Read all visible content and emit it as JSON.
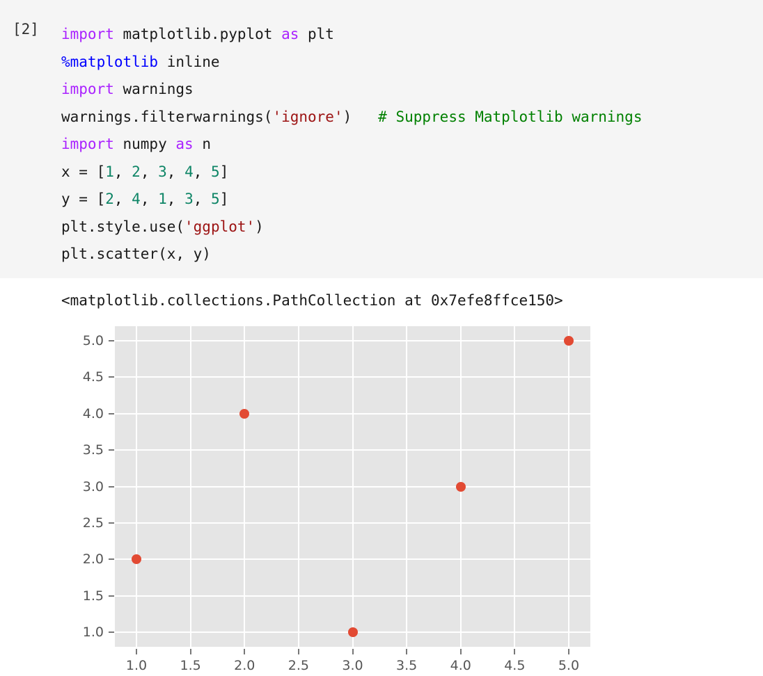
{
  "cell": {
    "prompt": "[2]",
    "lines": [
      [
        {
          "t": "import",
          "c": "kw"
        },
        {
          "t": " matplotlib.pyplot ",
          "c": "plain"
        },
        {
          "t": "as",
          "c": "kw"
        },
        {
          "t": " plt",
          "c": "plain"
        }
      ],
      [
        {
          "t": "%matplotlib",
          "c": "magic"
        },
        {
          "t": " inline",
          "c": "plain"
        }
      ],
      [
        {
          "t": "import",
          "c": "kw"
        },
        {
          "t": " warnings",
          "c": "plain"
        }
      ],
      [
        {
          "t": "warnings.filterwarnings(",
          "c": "plain"
        },
        {
          "t": "'ignore'",
          "c": "str"
        },
        {
          "t": ")   ",
          "c": "plain"
        },
        {
          "t": "# Suppress Matplotlib warnings",
          "c": "cmt"
        }
      ],
      [
        {
          "t": "import",
          "c": "kw"
        },
        {
          "t": " numpy ",
          "c": "plain"
        },
        {
          "t": "as",
          "c": "kw"
        },
        {
          "t": " n",
          "c": "plain"
        }
      ],
      [
        {
          "t": "x = [",
          "c": "plain"
        },
        {
          "t": "1",
          "c": "num"
        },
        {
          "t": ", ",
          "c": "plain"
        },
        {
          "t": "2",
          "c": "num"
        },
        {
          "t": ", ",
          "c": "plain"
        },
        {
          "t": "3",
          "c": "num"
        },
        {
          "t": ", ",
          "c": "plain"
        },
        {
          "t": "4",
          "c": "num"
        },
        {
          "t": ", ",
          "c": "plain"
        },
        {
          "t": "5",
          "c": "num"
        },
        {
          "t": "]",
          "c": "plain"
        }
      ],
      [
        {
          "t": "y = [",
          "c": "plain"
        },
        {
          "t": "2",
          "c": "num"
        },
        {
          "t": ", ",
          "c": "plain"
        },
        {
          "t": "4",
          "c": "num"
        },
        {
          "t": ", ",
          "c": "plain"
        },
        {
          "t": "1",
          "c": "num"
        },
        {
          "t": ", ",
          "c": "plain"
        },
        {
          "t": "3",
          "c": "num"
        },
        {
          "t": ", ",
          "c": "plain"
        },
        {
          "t": "5",
          "c": "num"
        },
        {
          "t": "]",
          "c": "plain"
        }
      ],
      [
        {
          "t": "plt.style.use(",
          "c": "plain"
        },
        {
          "t": "'ggplot'",
          "c": "str"
        },
        {
          "t": ")",
          "c": "plain"
        }
      ],
      [
        {
          "t": "plt.scatter(x, y)",
          "c": "plain"
        }
      ]
    ]
  },
  "output": {
    "repr_text": "<matplotlib.collections.PathCollection at 0x7efe8ffce150>"
  },
  "chart_data": {
    "type": "scatter",
    "title": "",
    "xlabel": "",
    "ylabel": "",
    "x": [
      1,
      2,
      3,
      4,
      5
    ],
    "y": [
      2,
      4,
      1,
      3,
      5
    ],
    "points": [
      {
        "x": 1,
        "y": 2
      },
      {
        "x": 2,
        "y": 4
      },
      {
        "x": 3,
        "y": 1
      },
      {
        "x": 4,
        "y": 3
      },
      {
        "x": 5,
        "y": 5
      }
    ],
    "xlim": [
      0.8,
      5.2
    ],
    "ylim": [
      0.8,
      5.2
    ],
    "xticks": [
      1.0,
      1.5,
      2.0,
      2.5,
      3.0,
      3.5,
      4.0,
      4.5,
      5.0
    ],
    "yticks": [
      1.0,
      1.5,
      2.0,
      2.5,
      3.0,
      3.5,
      4.0,
      4.5,
      5.0
    ],
    "xticklabels": [
      "1.0",
      "1.5",
      "2.0",
      "2.5",
      "3.0",
      "3.5",
      "4.0",
      "4.5",
      "5.0"
    ],
    "yticklabels": [
      "1.0",
      "1.5",
      "2.0",
      "2.5",
      "3.0",
      "3.5",
      "4.0",
      "4.5",
      "5.0"
    ],
    "grid": true,
    "legend": null,
    "style": "ggplot",
    "colors": {
      "marker": "#E24A33",
      "axes_background": "#e5e5e5",
      "gridline": "#ffffff",
      "tick_label": "#555555",
      "figure_background": "#ffffff"
    }
  }
}
